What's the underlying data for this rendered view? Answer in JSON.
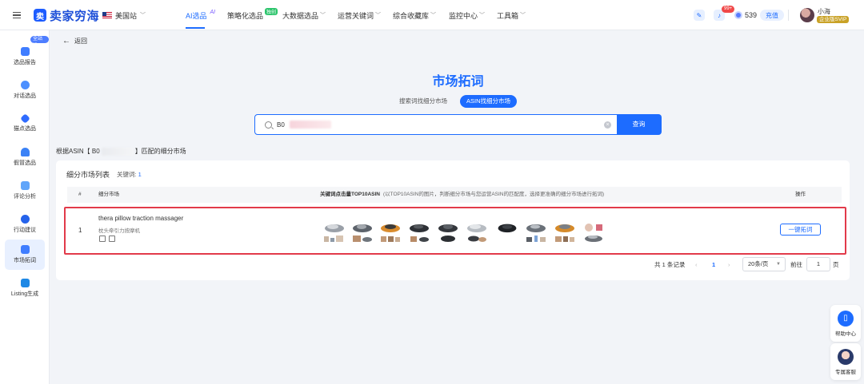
{
  "topbar": {
    "logo_text": "卖家穷海",
    "site": "美国站",
    "nav": [
      "AI选品",
      "策略化选品",
      "大数据选品",
      "运营关键词",
      "综合收藏库",
      "监控中心",
      "工具箱"
    ],
    "ai_badge": "AI",
    "exclusive_badge": "独创",
    "notification_count": "99+",
    "coins": "539",
    "recharge": "充值",
    "user_name": "小海",
    "vip_label": "企业版SVIP"
  },
  "sidebar": {
    "all_site_badge": "全站投",
    "items": [
      "选品报告",
      "对话选品",
      "猫点选品",
      "假冒选品",
      "评论分析",
      "行动建议",
      "市场拓词",
      "Listing生成"
    ]
  },
  "float": {
    "help": "帮助中心",
    "service": "专属客服"
  },
  "main": {
    "back": "返回",
    "title": "市场拓词",
    "tabs": [
      "搜索词找细分市场",
      "ASIN找细分市场"
    ],
    "search_value": "B0",
    "search_btn": "查询",
    "match_prefix": "根据ASIN【 B0",
    "match_suffix": "】匹配的细分市场",
    "card_title": "细分市场列表",
    "kw_label": "关键词: ",
    "kw_count": "1",
    "col_index": "#",
    "col_market": "细分市场",
    "col_top": "关键词点击量TOP10ASIN",
    "col_top_note": "(以TOP10ASIN的图片，判断细分市场与您运营ASIN的匹配度，选择更准确的细分市场进行拓词)",
    "col_action": "操作",
    "row": {
      "index": "1",
      "keyword_en": "thera pillow traction massager",
      "keyword_cn": "枕头牵引力按摩机",
      "action": "一键拓词"
    },
    "pager": {
      "total": "共 1 条记录",
      "page": "1",
      "page_size": "20条/页",
      "goto": "前往",
      "goto_value": "1",
      "page_suffix": "页"
    }
  },
  "colors": {
    "accent": "#1d6cff",
    "highlight_frame": "#e23a4a"
  }
}
